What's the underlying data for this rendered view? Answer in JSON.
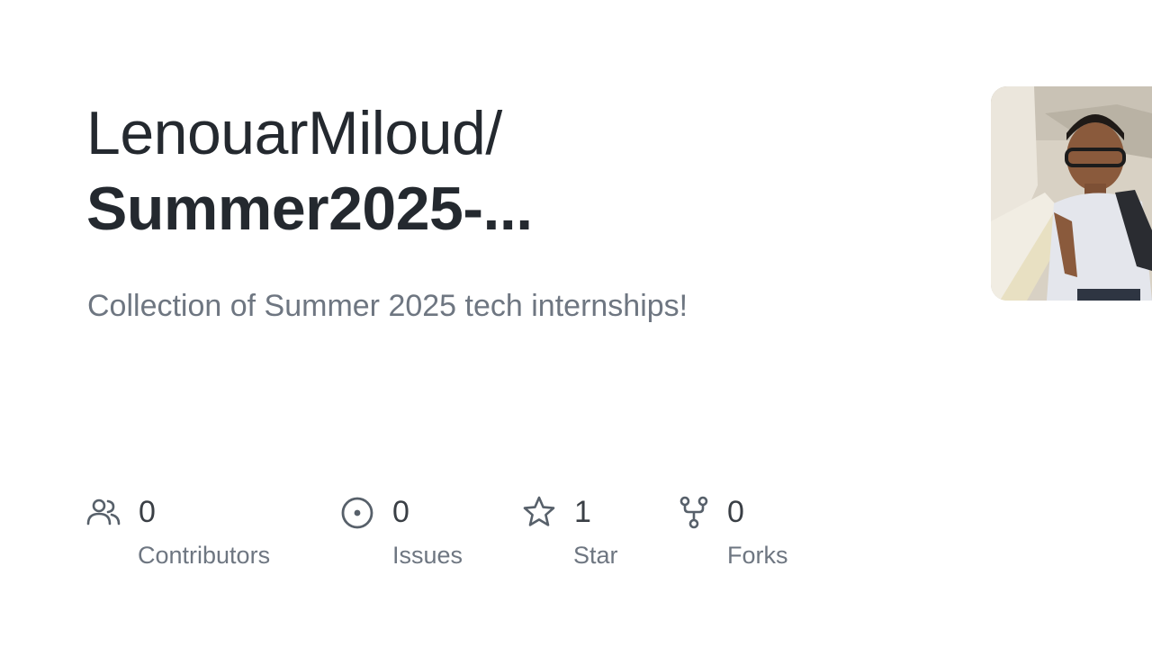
{
  "repository": {
    "owner": "LenouarMiloud/",
    "name": "Summer2025-...",
    "description": "Collection of Summer 2025 tech internships!"
  },
  "stats": {
    "contributors": {
      "value": "0",
      "label": "Contributors",
      "icon": "people-icon"
    },
    "issues": {
      "value": "0",
      "label": "Issues",
      "icon": "issue-circle-icon"
    },
    "stars": {
      "value": "1",
      "label": "Star",
      "icon": "star-icon"
    },
    "forks": {
      "value": "0",
      "label": "Forks",
      "icon": "fork-icon"
    }
  },
  "colors": {
    "title": "#24292f",
    "muted": "#6e7681",
    "background": "#ffffff"
  }
}
